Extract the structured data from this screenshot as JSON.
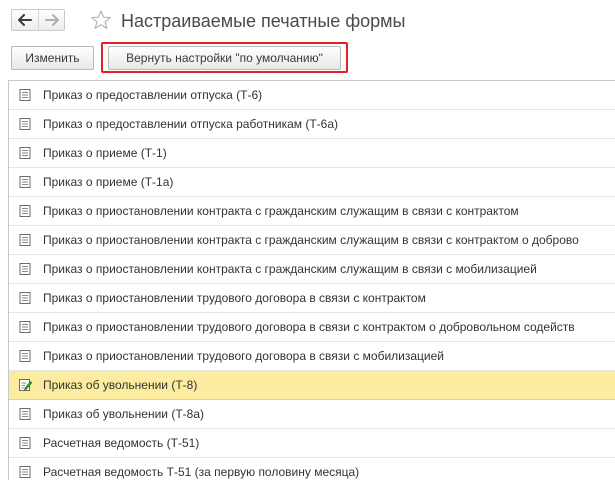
{
  "header": {
    "title": "Настраиваемые печатные формы",
    "back_icon": "arrow-left-icon",
    "forward_icon": "arrow-right-icon",
    "favorite_icon": "star-icon"
  },
  "toolbar": {
    "edit_label": "Изменить",
    "reset_label": "Вернуть настройки \"по умолчанию\"",
    "highlight_color": "#e2222b"
  },
  "list": {
    "selected_color": "#fbec9f",
    "selected_index": 11,
    "items": [
      {
        "label": "Приказ о предоставлении отпуска (Т-6)",
        "icon": "document-icon"
      },
      {
        "label": "Приказ о предоставлении отпуска работникам (Т-6а)",
        "icon": "document-icon"
      },
      {
        "label": "Приказ о приеме (Т-1)",
        "icon": "document-icon"
      },
      {
        "label": "Приказ о приеме (Т-1а)",
        "icon": "document-icon"
      },
      {
        "label": "Приказ о приостановлении контракта с гражданским служащим в связи с контрактом",
        "icon": "document-icon"
      },
      {
        "label": "Приказ о приостановлении контракта с гражданским служащим в связи с контрактом о доброво",
        "icon": "document-icon"
      },
      {
        "label": "Приказ о приостановлении контракта с гражданским служащим в связи с мобилизацией",
        "icon": "document-icon"
      },
      {
        "label": "Приказ о приостановлении трудового договора в связи с контрактом",
        "icon": "document-icon"
      },
      {
        "label": "Приказ о приостановлении трудового договора в связи с контрактом о добровольном содейств",
        "icon": "document-icon"
      },
      {
        "label": "Приказ о приостановлении трудового договора в связи с мобилизацией",
        "icon": "document-icon"
      },
      {
        "label": "Приказ об увольнении (Т-8)",
        "icon": "edited-document-icon"
      },
      {
        "label": "Приказ об увольнении (Т-8а)",
        "icon": "document-icon"
      },
      {
        "label": "Расчетная ведомость (Т-51)",
        "icon": "document-icon"
      },
      {
        "label": "Расчетная ведомость Т-51 (за первую половину месяца)",
        "icon": "document-icon"
      }
    ]
  }
}
